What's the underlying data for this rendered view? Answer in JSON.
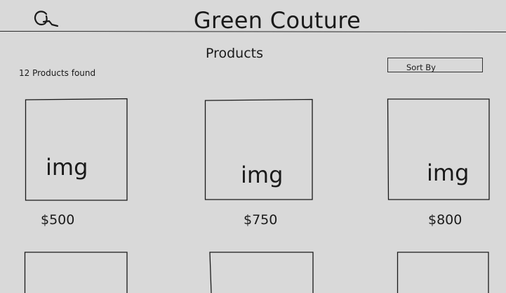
{
  "header": {
    "brand": "Green Couture",
    "search_icon": "search-icon"
  },
  "main": {
    "title": "Products",
    "result_count": "12 Products found",
    "sort": {
      "label": "Sort By"
    }
  },
  "products": [
    {
      "image_label": "img",
      "price": "$500"
    },
    {
      "image_label": "img",
      "price": "$750"
    },
    {
      "image_label": "img",
      "price": "$800"
    },
    {
      "image_label": "",
      "price": ""
    },
    {
      "image_label": "",
      "price": ""
    },
    {
      "image_label": "",
      "price": ""
    }
  ]
}
